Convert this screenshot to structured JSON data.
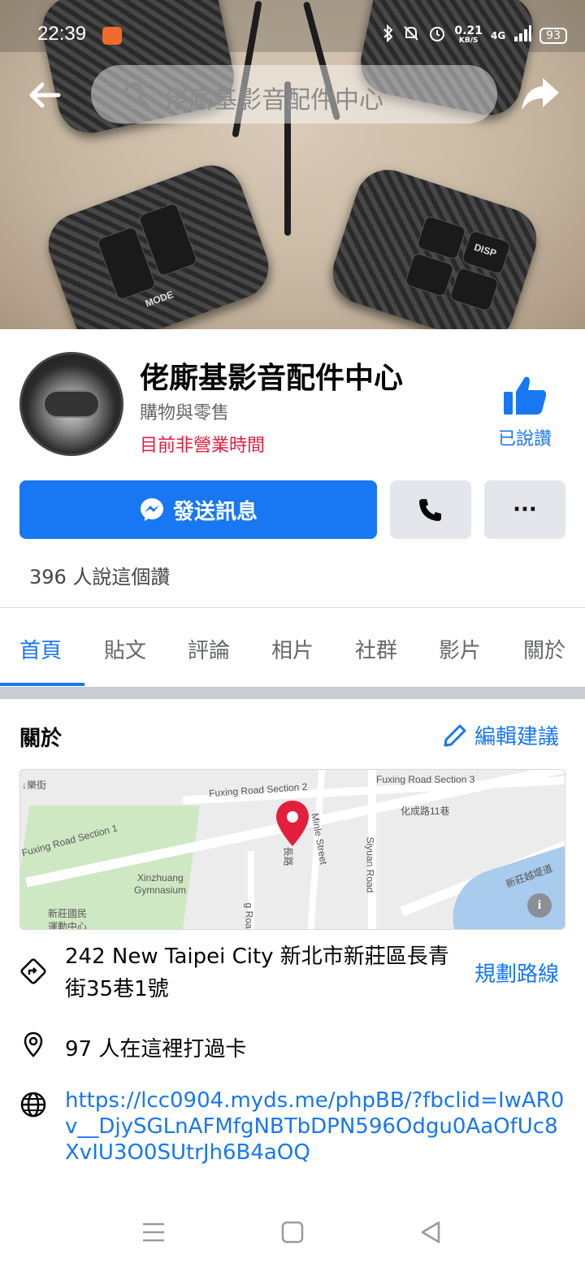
{
  "status_bar": {
    "time": "22:39",
    "speed_value": "0.21",
    "speed_unit": "KB/S",
    "network": "4G",
    "battery": "93"
  },
  "search": {
    "placeholder": "佬廝基影音配件中心"
  },
  "page": {
    "name": "佬廝基影音配件中心",
    "category": "購物與零售",
    "status": "目前非營業時間",
    "liked_label": "已說讚",
    "likes_count": "396 人說這個讚"
  },
  "actions": {
    "message_label": "發送訊息",
    "more_label": "···"
  },
  "tabs": [
    {
      "label": "首頁",
      "active": true
    },
    {
      "label": "貼文",
      "active": false
    },
    {
      "label": "評論",
      "active": false
    },
    {
      "label": "相片",
      "active": false
    },
    {
      "label": "社群",
      "active": false
    },
    {
      "label": "影片",
      "active": false
    },
    {
      "label": "關於",
      "active": false
    }
  ],
  "about": {
    "title": "關於",
    "edit_label": "編輯建議"
  },
  "map": {
    "labels": {
      "l1": "↓樂街",
      "l2": "Fuxing Road Section 2",
      "l3": "Fuxing Road Section 3",
      "l4": "化成路11巷",
      "l5": "Fuxing Road Section 1",
      "l6": "Minle Street",
      "l7": "Siyuan Road",
      "l8": "Xinzhuang",
      "l9": "Gymnasium",
      "l10": "新莊國民",
      "l11": "運動中心",
      "l12": "新莊越堤道",
      "l13": "長路",
      "l14": "g Road"
    },
    "info_icon": "i"
  },
  "info": {
    "address": "242 New Taipei City 新北市新莊區長青街35巷1號",
    "route_label": "規劃路線",
    "checkins": "97 人在這裡打過卡",
    "website": "https://lcc0904.myds.me/phpBB/?fbclid=IwAR0v__DjySGLnAFMfgNBTbDPN596Odgu0AaOfUc8XvIU3O0SUtrJh6B4aOQ"
  },
  "colors": {
    "accent": "#1877f2",
    "status_closed": "#e41e3f",
    "secondary_text": "#65676b",
    "button_gray": "#e4e6eb"
  },
  "icons": [
    "back-arrow-icon",
    "search-icon",
    "share-icon",
    "thumbs-up-icon",
    "messenger-icon",
    "phone-icon",
    "more-icon",
    "pencil-icon",
    "map-pin-icon",
    "directions-icon",
    "location-icon",
    "globe-icon",
    "menu-icon",
    "home-square-icon",
    "back-triangle-icon"
  ]
}
